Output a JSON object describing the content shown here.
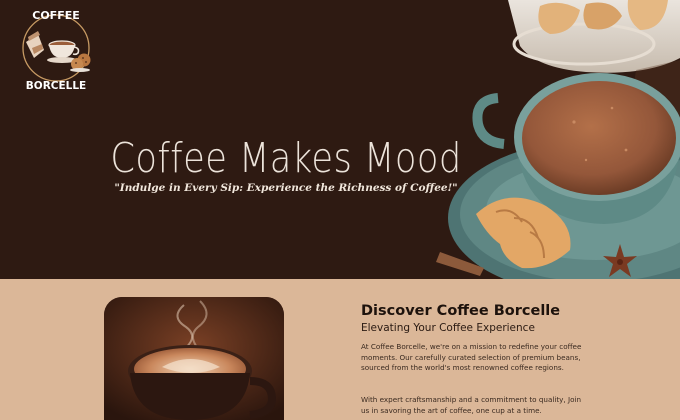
{
  "brand": {
    "logo_top_text": "COFFEE",
    "logo_bottom_text": "BORCELLE"
  },
  "hero": {
    "title": "Coffee Makes Mood",
    "tagline": "\"Indulge in Every Sip: Experience the Richness of Coffee!\""
  },
  "about": {
    "title": "Discover Coffee Borcelle",
    "subtitle": "Elevating Your Coffee Experience",
    "paragraph_1": "At Coffee Borcelle, we're on a mission to redefine your coffee moments. Our carefully curated selection of premium beans, sourced from the world's most renowned coffee regions.",
    "paragraph_2": "With expert craftsmanship and a commitment to quality, Join us in savoring the art of coffee, one cup at a time."
  },
  "colors": {
    "hero_bg": "#2e1a12",
    "section_bg": "#dbb798",
    "cup": "#5e8a86",
    "coffee": "#9a5d3a"
  }
}
